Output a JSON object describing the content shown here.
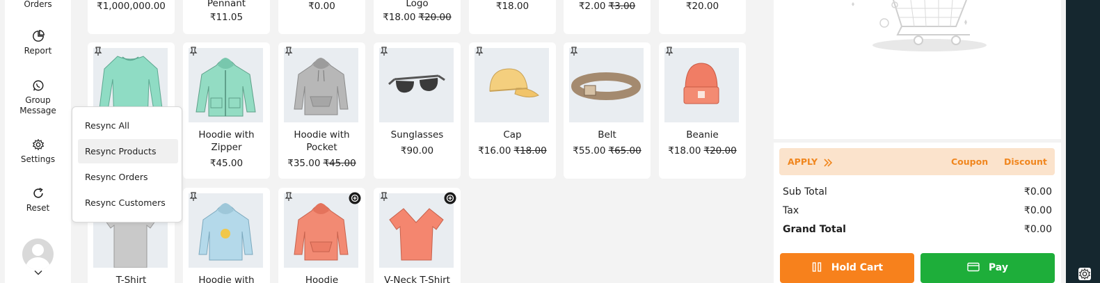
{
  "sidebar": {
    "orders_label": "Orders",
    "report_label": "Report",
    "group_message_label": "Group Message",
    "settings_label": "Settings",
    "reset_label": "Reset"
  },
  "resync_menu": {
    "items": [
      "Resync All",
      "Resync Products",
      "Resync Orders",
      "Resync Customers"
    ],
    "active_index": 1
  },
  "top_row": [
    {
      "price": "₹1,000,000.00"
    },
    {
      "name_tail": "Pennant",
      "price": "₹11.05"
    },
    {
      "price": "₹0.00"
    },
    {
      "name_tail": "Logo",
      "price": "₹18.00",
      "old_price": "₹20.00"
    },
    {
      "price": "₹18.00"
    },
    {
      "price": "₹2.00",
      "old_price": "₹3.00"
    },
    {
      "price": "₹20.00"
    }
  ],
  "products_row2": [
    {
      "name": "",
      "price": "",
      "icon": "long-sleeve-tee"
    },
    {
      "name": "Hoodie with Zipper",
      "price": "₹45.00",
      "icon": "hoodie-zipper"
    },
    {
      "name": "Hoodie with Pocket",
      "price": "₹35.00",
      "old_price": "₹45.00",
      "icon": "hoodie-pocket"
    },
    {
      "name": "Sunglasses",
      "price": "₹90.00",
      "icon": "sunglasses"
    },
    {
      "name": "Cap",
      "price": "₹16.00",
      "old_price": "₹18.00",
      "icon": "cap"
    },
    {
      "name": "Belt",
      "price": "₹55.00",
      "old_price": "₹65.00",
      "icon": "belt"
    },
    {
      "name": "Beanie",
      "price": "₹18.00",
      "old_price": "₹20.00",
      "icon": "beanie"
    }
  ],
  "products_row3": [
    {
      "name": "T-Shirt",
      "icon": "t-shirt"
    },
    {
      "name": "Hoodie with",
      "icon": "hoodie-logo"
    },
    {
      "name": "Hoodie",
      "icon": "hoodie"
    },
    {
      "name": "V-Neck T-Shirt",
      "icon": "v-neck-tshirt"
    }
  ],
  "cart": {
    "apply_label": "APPLY",
    "coupon_label": "Coupon",
    "discount_label": "Discount",
    "sub_total_label": "Sub Total",
    "sub_total_value": "₹0.00",
    "tax_label": "Tax",
    "tax_value": "₹0.00",
    "grand_total_label": "Grand Total",
    "grand_total_value": "₹0.00",
    "hold_cart_label": "Hold Cart",
    "pay_label": "Pay"
  },
  "colors": {
    "accent_orange": "#f7811c",
    "pay_green": "#1eae3a",
    "apply_bg": "#fbe3cc"
  }
}
